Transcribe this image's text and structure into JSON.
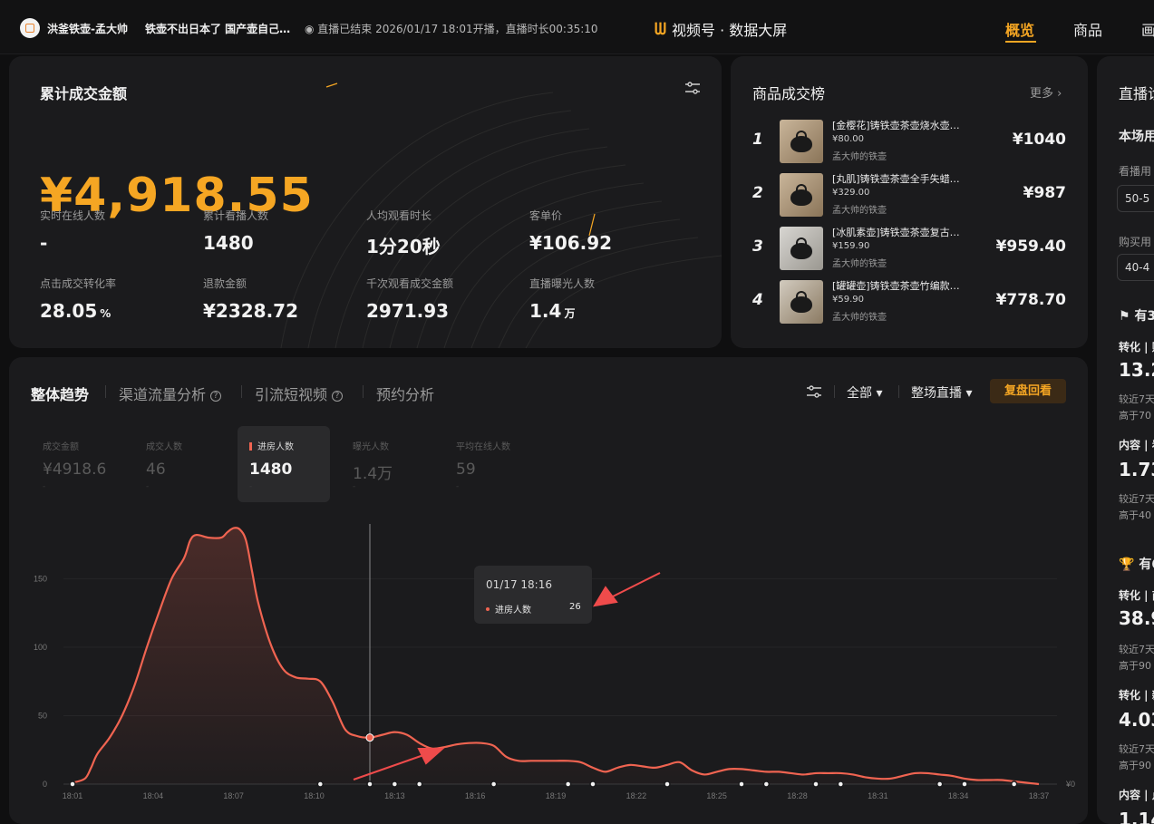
{
  "header": {
    "shop_name": "洪釜铁壶-孟大帅",
    "live_title": "铁壶不出日本了 国产壶自己…",
    "live_status": "◉ 直播已结束 2026/01/17 18:01开播，直播时长00:35:10",
    "brand": "视频号 · 数据大屏",
    "tabs": [
      "概览",
      "商品",
      "画"
    ]
  },
  "gmv_card": {
    "title": "累计成交金额",
    "value": "¥4,918.55",
    "metrics": [
      {
        "label": "实时在线人数",
        "value": "-",
        "unit": ""
      },
      {
        "label": "累计看播人数",
        "value": "1480",
        "unit": ""
      },
      {
        "label": "人均观看时长",
        "value": "1分20秒",
        "unit": ""
      },
      {
        "label": "客单价",
        "value": "¥106.92",
        "unit": ""
      },
      {
        "label": "点击成交转化率",
        "value": "28.05",
        "unit": "%"
      },
      {
        "label": "退款金额",
        "value": "¥2328.72",
        "unit": ""
      },
      {
        "label": "千次观看成交金额",
        "value": "2971.93",
        "unit": ""
      },
      {
        "label": "直播曝光人数",
        "value": "1.4",
        "unit": "万"
      }
    ]
  },
  "rank_card": {
    "title": "商品成交榜",
    "more": "更多 ›",
    "items": [
      {
        "rank": "1",
        "name": "[金樱花]铸铁壶茶壶烧水壶…",
        "price": "¥80.00",
        "shop": "孟大帅的铁壶",
        "gmv": "¥1040"
      },
      {
        "rank": "2",
        "name": "[丸肌]铸铁壶茶壶全手失蜡…",
        "price": "¥329.00",
        "shop": "孟大帅的铁壶",
        "gmv": "¥987"
      },
      {
        "rank": "3",
        "name": "[冰肌素壶]铸铁壶茶壶复古…",
        "price": "¥159.90",
        "shop": "孟大帅的铁壶",
        "gmv": "¥959.40"
      },
      {
        "rank": "4",
        "name": "[罐罐壶]铸铁壶茶壶竹编款…",
        "price": "¥59.90",
        "shop": "孟大帅的铁壶",
        "gmv": "¥778.70"
      }
    ]
  },
  "right_panel": {
    "title": "直播诊",
    "subtitle": "本场用",
    "watch_label": "看播用",
    "watch_pill": "50-5",
    "buy_label": "购买用",
    "buy_pill": "40-4",
    "section1": "有3",
    "s1_rows": [
      {
        "title": "转化 | 贩",
        "value": "13.2",
        "compare": "较近7天",
        "higher": "高于70"
      },
      {
        "title": "内容 | 看",
        "value": "1.73",
        "compare": "较近7天",
        "higher": "高于40"
      }
    ],
    "section2": "有6",
    "s2_rows": [
      {
        "title": "转化 | 商",
        "value": "38.9",
        "compare": "较近7天",
        "higher": "高于90"
      },
      {
        "title": "转化 | 新",
        "value": "4.03",
        "compare": "较近7天",
        "higher": "高于90"
      }
    ],
    "last_title": "内容 | 点",
    "last_value": "1.14"
  },
  "trend_card": {
    "tabs": [
      "整体趋势",
      "渠道流量分析",
      "引流短视频",
      "预约分析"
    ],
    "filter_all": "全部 ▾",
    "filter_scope": "整场直播 ▾",
    "replay_button": "复盘回看",
    "kpis": [
      {
        "label": "成交金额",
        "value": "¥4918.6",
        "dash": "-",
        "active": false
      },
      {
        "label": "成交人数",
        "value": "46",
        "dash": "-",
        "active": false
      },
      {
        "label": "进房人数",
        "value": "1480",
        "dash": "-",
        "active": true
      },
      {
        "label": "曝光人数",
        "value": "1.4万",
        "dash": "-",
        "active": false
      },
      {
        "label": "平均在线人数",
        "value": "59",
        "dash": "-",
        "active": false
      }
    ],
    "tooltip": {
      "time": "01/17 18:16",
      "label": "进房人数",
      "value": "26"
    }
  },
  "chart_data": {
    "type": "line",
    "series": [
      {
        "name": "进房人数",
        "color": "#f06451"
      }
    ],
    "x_ticks": [
      "18:01",
      "18:04",
      "18:07",
      "18:10",
      "18:13",
      "18:16",
      "18:19",
      "18:22",
      "18:25",
      "18:28",
      "18:31",
      "18:34",
      "18:37"
    ],
    "y_ticks": [
      "0",
      "50",
      "100",
      "150"
    ],
    "y_right_label": "¥0",
    "ylim": [
      0,
      190
    ],
    "points": [
      [
        0,
        1
      ],
      [
        1,
        4
      ],
      [
        1.5,
        12
      ],
      [
        2,
        22
      ],
      [
        3,
        34
      ],
      [
        4,
        50
      ],
      [
        5,
        72
      ],
      [
        6,
        100
      ],
      [
        7,
        126
      ],
      [
        8,
        150
      ],
      [
        9,
        165
      ],
      [
        9.5,
        178
      ],
      [
        10,
        182
      ],
      [
        11,
        180
      ],
      [
        12,
        180
      ],
      [
        12.5,
        184
      ],
      [
        13,
        187
      ],
      [
        13.5,
        186
      ],
      [
        14,
        178
      ],
      [
        14.5,
        155
      ],
      [
        15,
        132
      ],
      [
        16,
        102
      ],
      [
        17,
        84
      ],
      [
        18,
        78
      ],
      [
        19,
        77
      ],
      [
        20,
        75
      ],
      [
        21,
        60
      ],
      [
        22,
        40
      ],
      [
        23,
        35
      ],
      [
        24,
        34
      ],
      [
        25,
        36
      ],
      [
        26,
        38
      ],
      [
        27,
        36
      ],
      [
        28,
        30
      ],
      [
        29,
        26
      ],
      [
        30,
        27
      ],
      [
        31,
        29
      ],
      [
        32,
        30
      ],
      [
        33,
        30
      ],
      [
        34,
        28
      ],
      [
        35,
        20
      ],
      [
        36,
        17
      ],
      [
        37,
        17
      ],
      [
        38,
        17
      ],
      [
        39,
        17
      ],
      [
        40,
        17
      ],
      [
        41,
        16
      ],
      [
        42,
        12
      ],
      [
        43,
        9
      ],
      [
        44,
        12
      ],
      [
        45,
        14
      ],
      [
        46,
        13
      ],
      [
        47,
        12
      ],
      [
        48,
        14
      ],
      [
        49,
        16
      ],
      [
        50,
        10
      ],
      [
        51,
        7
      ],
      [
        52,
        9
      ],
      [
        53,
        11
      ],
      [
        54,
        11
      ],
      [
        55,
        10
      ],
      [
        56,
        9
      ],
      [
        57,
        9
      ],
      [
        58,
        8
      ],
      [
        59,
        7
      ],
      [
        60,
        8
      ],
      [
        61,
        8
      ],
      [
        62,
        8
      ],
      [
        63,
        7
      ],
      [
        64,
        5
      ],
      [
        65,
        4
      ],
      [
        66,
        4
      ],
      [
        67,
        6
      ],
      [
        68,
        8
      ],
      [
        69,
        8
      ],
      [
        70,
        7
      ],
      [
        71,
        6
      ],
      [
        72,
        4
      ],
      [
        73,
        3
      ],
      [
        74,
        3
      ],
      [
        75,
        3
      ],
      [
        76,
        2
      ],
      [
        77,
        1
      ],
      [
        78,
        0
      ]
    ],
    "highlight_index": 29,
    "markers_x": [
      0,
      20,
      24,
      26,
      28,
      34,
      40,
      42,
      48,
      54,
      56,
      60,
      62,
      70,
      72,
      76
    ]
  }
}
